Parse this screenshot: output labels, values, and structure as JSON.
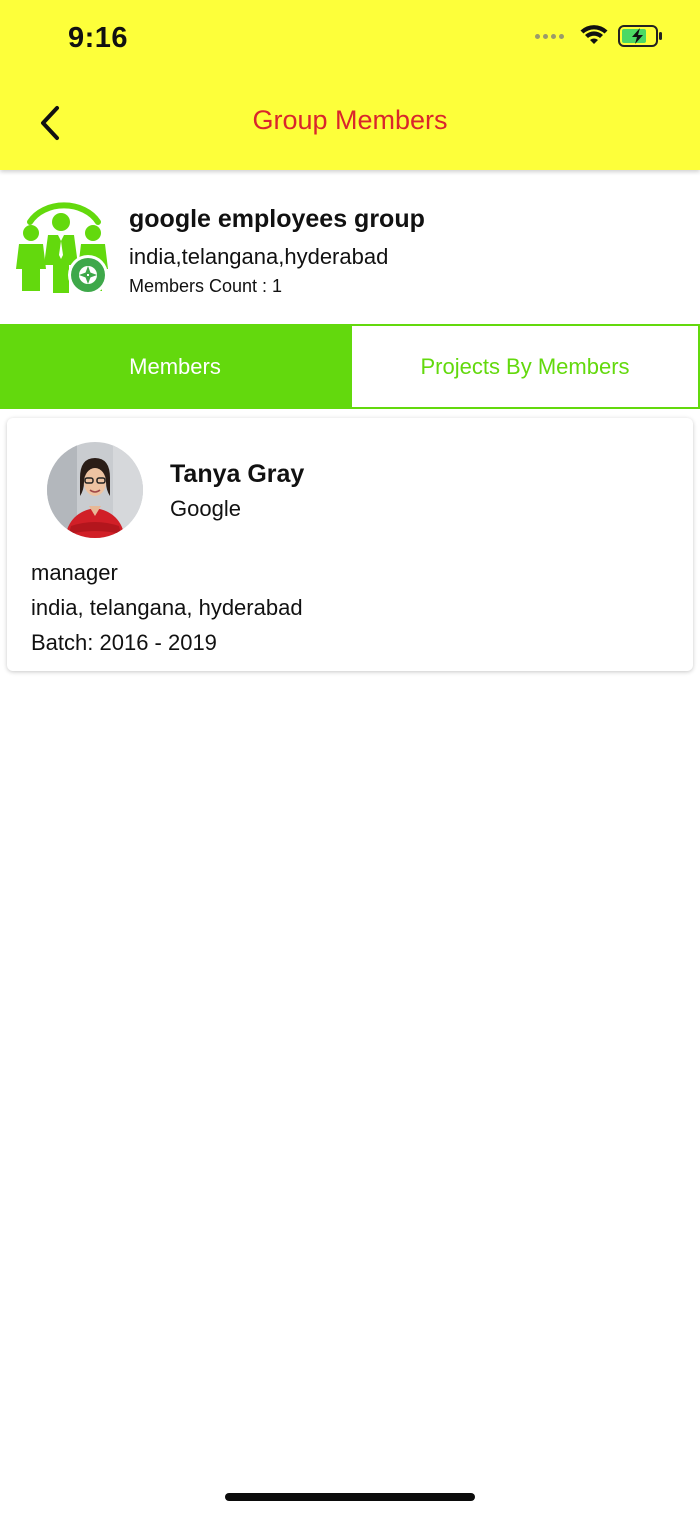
{
  "status_bar": {
    "time": "9:16"
  },
  "header": {
    "title": "Group Members",
    "back_icon": "chevron-left-icon"
  },
  "group": {
    "name": "google employees group",
    "location": "india,telangana,hyderabad",
    "members_count": "Members Count : 1",
    "logo_icon": "group-people-icon"
  },
  "tabs": [
    {
      "label": "Members",
      "active": true
    },
    {
      "label": "Projects By Members",
      "active": false
    }
  ],
  "members": [
    {
      "name": "Tanya Gray",
      "company": "Google",
      "role": "manager",
      "location": "india, telangana, hyderabad",
      "batch": "Batch: 2016 - 2019"
    }
  ],
  "colors": {
    "header_bg": "#fdff3a",
    "title": "#d9262c",
    "accent_green": "#63d90d"
  }
}
